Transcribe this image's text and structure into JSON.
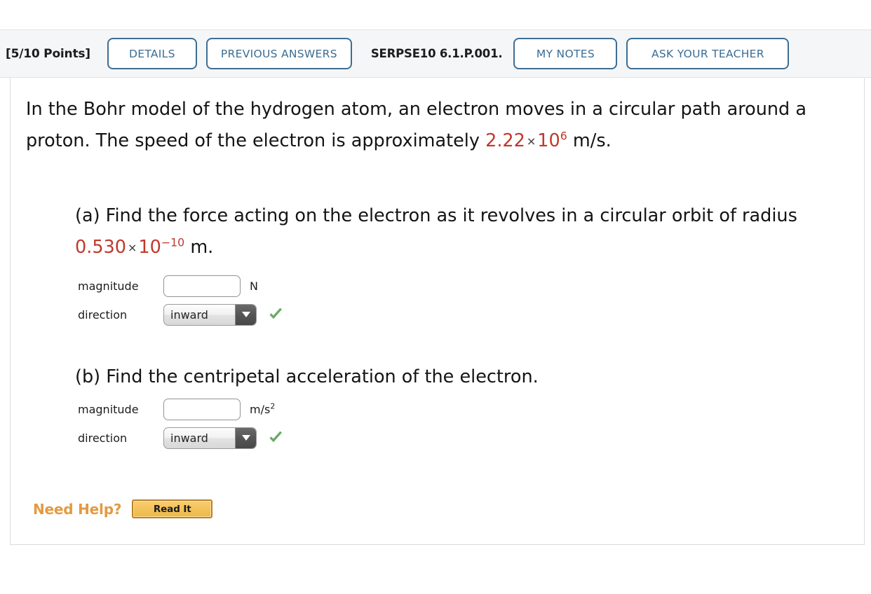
{
  "header": {
    "points": "[5/10 Points]",
    "details_label": "DETAILS",
    "previous_answers_label": "PREVIOUS ANSWERS",
    "question_code": "SERPSE10 6.1.P.001.",
    "my_notes_label": "MY NOTES",
    "ask_teacher_label": "ASK YOUR TEACHER"
  },
  "question": {
    "stem_part1": "In the Bohr model of the hydrogen atom, an electron moves in a circular path around a proton. The speed of the electron is approximately ",
    "speed_value": "2.22",
    "speed_times": "×",
    "speed_base": "10",
    "speed_exponent": "6",
    "speed_unit": " m/s.",
    "part_a_text1": "(a) Find the force acting on the electron as it revolves in a circular orbit of radius ",
    "radius_value": "0.530",
    "radius_times": "×",
    "radius_base": "10",
    "radius_exponent": "−10",
    "radius_unit": " m.",
    "part_b_text": "(b) Find the centripetal acceleration of the electron."
  },
  "answers": {
    "a": {
      "magnitude_label": "magnitude",
      "magnitude_value": "",
      "magnitude_unit": "N",
      "magnitude_unit_sup": "",
      "direction_label": "direction",
      "direction_value": "inward",
      "status_icon": "green-check-icon"
    },
    "b": {
      "magnitude_label": "magnitude",
      "magnitude_value": "",
      "magnitude_unit": "m/s",
      "magnitude_unit_sup": "2",
      "direction_label": "direction",
      "direction_value": "inward",
      "status_icon": "green-check-icon"
    }
  },
  "help": {
    "label": "Need Help?",
    "button_label": "Read It"
  },
  "colors": {
    "accent_blue": "#3c6e94",
    "value_red": "#c0392b",
    "check_green": "#6aaa64",
    "help_orange": "#e39a42",
    "header_bg": "#f5f6f7"
  }
}
